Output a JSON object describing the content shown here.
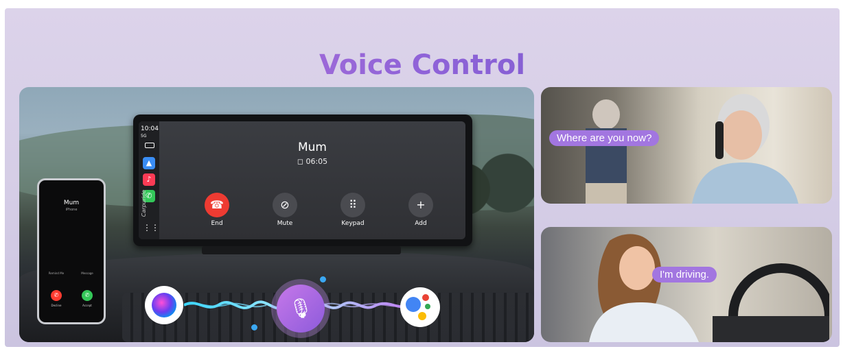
{
  "title": "Voice Control",
  "head_unit": {
    "time": "10:04",
    "signal": "5G",
    "brand": "Carpuride",
    "caller_name": "Mum",
    "call_duration": "06:05",
    "buttons": [
      {
        "label": "End",
        "icon": "phone-hangup-icon"
      },
      {
        "label": "Mute",
        "icon": "mic-off-icon"
      },
      {
        "label": "Keypad",
        "icon": "keypad-icon"
      },
      {
        "label": "Add",
        "icon": "plus-icon"
      }
    ],
    "dock_apps": [
      "maps-icon",
      "music-icon",
      "phone-icon"
    ]
  },
  "phone": {
    "caller_name": "Mum",
    "subtitle": "iPhone",
    "remind": "Remind Me",
    "message": "Message",
    "decline": "Decline",
    "accept": "Accept"
  },
  "voice_assistants": [
    "siri-icon",
    "voice-mic-icon",
    "google-assistant-icon"
  ],
  "photos": {
    "top_bubble": "Where are you now?",
    "bottom_bubble": "I'm driving."
  },
  "colors": {
    "accent": "#a276e0",
    "end_call": "#ee3b32",
    "accept_call": "#34c759"
  }
}
